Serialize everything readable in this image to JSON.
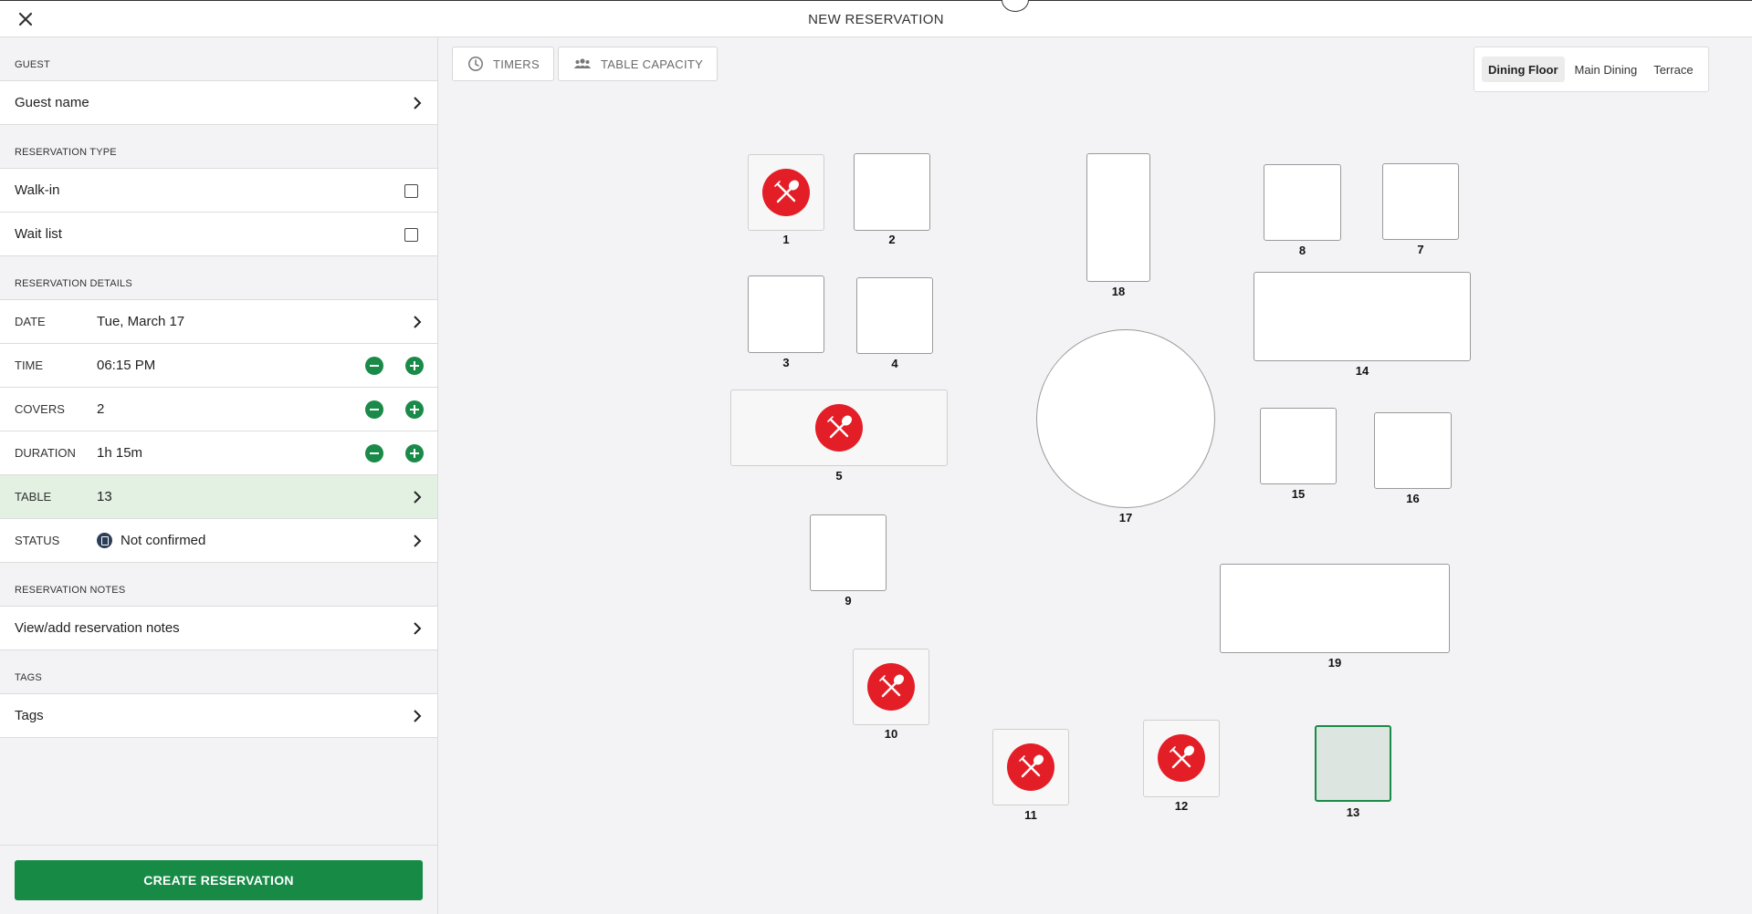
{
  "header": {
    "title": "NEW RESERVATION"
  },
  "sidebar": {
    "guest": {
      "section": "GUEST",
      "name_label": "Guest name"
    },
    "type": {
      "section": "RESERVATION TYPE",
      "walk_in": "Walk-in",
      "wait_list": "Wait list"
    },
    "details": {
      "section": "RESERVATION DETAILS",
      "date": {
        "label": "DATE",
        "value": "Tue, March 17"
      },
      "time": {
        "label": "TIME",
        "value": "06:15 PM"
      },
      "covers": {
        "label": "COVERS",
        "value": "2"
      },
      "duration": {
        "label": "DURATION",
        "value": "1h 15m"
      },
      "table": {
        "label": "TABLE",
        "value": "13"
      },
      "status": {
        "label": "STATUS",
        "value": "Not confirmed"
      }
    },
    "notes": {
      "section": "RESERVATION NOTES",
      "label": "View/add reservation notes"
    },
    "tags": {
      "section": "TAGS",
      "label": "Tags"
    },
    "create_label": "CREATE RESERVATION"
  },
  "toolbar": {
    "timers": "TIMERS",
    "table_capacity": "TABLE CAPACITY"
  },
  "areas": {
    "options": [
      "Dining Floor",
      "Main Dining",
      "Terrace"
    ],
    "selected": "Dining Floor"
  },
  "tables": [
    {
      "number": "1",
      "status": "occupied"
    },
    {
      "number": "2",
      "status": "available"
    },
    {
      "number": "3",
      "status": "available"
    },
    {
      "number": "4",
      "status": "available"
    },
    {
      "number": "5",
      "status": "occupied"
    },
    {
      "number": "7",
      "status": "available"
    },
    {
      "number": "8",
      "status": "available"
    },
    {
      "number": "9",
      "status": "available"
    },
    {
      "number": "10",
      "status": "occupied"
    },
    {
      "number": "11",
      "status": "occupied"
    },
    {
      "number": "12",
      "status": "occupied"
    },
    {
      "number": "13",
      "status": "selected"
    },
    {
      "number": "14",
      "status": "available"
    },
    {
      "number": "15",
      "status": "available"
    },
    {
      "number": "16",
      "status": "available"
    },
    {
      "number": "17",
      "status": "available"
    },
    {
      "number": "18",
      "status": "available"
    },
    {
      "number": "19",
      "status": "available"
    }
  ],
  "colors": {
    "accent_green": "#178a46",
    "occupied_red": "#e41e26",
    "selected_fill": "#dce5e0"
  },
  "icons": {
    "close": "close-icon",
    "chevron": "chevron-right-icon",
    "timer": "clock-icon",
    "capacity": "people-icon",
    "occupied": "fork-spoon-icon"
  }
}
